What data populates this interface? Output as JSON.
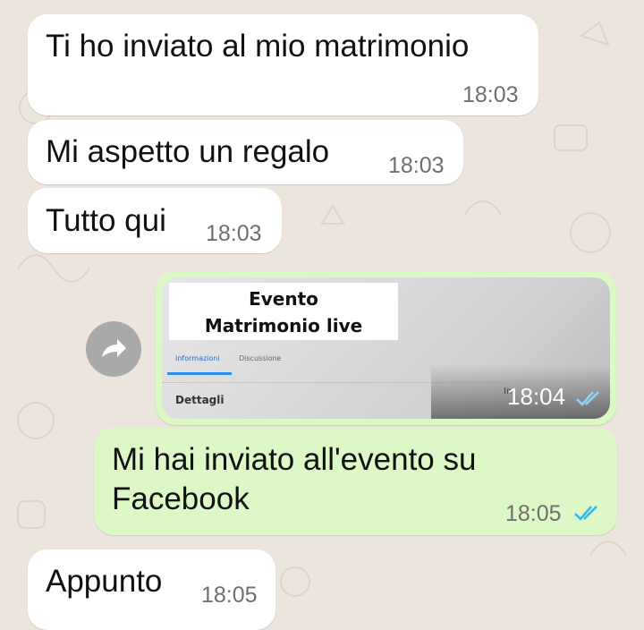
{
  "colors": {
    "background": "#ece5dd",
    "incoming_bubble": "#ffffff",
    "outgoing_bubble": "#dcf8c6",
    "read_ticks": "#34b7f1",
    "timestamp": "#6f6f6f"
  },
  "messages": [
    {
      "direction": "incoming",
      "text": "Ti ho inviato al mio matrimonio",
      "time": "18:03"
    },
    {
      "direction": "incoming",
      "text": "Mi aspetto un regalo",
      "time": "18:03"
    },
    {
      "direction": "incoming",
      "text": "Tutto qui",
      "time": "18:03"
    },
    {
      "direction": "outgoing",
      "type": "image",
      "time": "18:04",
      "status": "read",
      "status_icon": "double-check-icon",
      "image": {
        "caption_line1": "Evento",
        "caption_line2": "Matrimonio live",
        "tab_info": "Informazioni",
        "tab_discussion": "Discussione",
        "details_label": "Dettagli",
        "overlay_glyph": "In"
      }
    },
    {
      "direction": "outgoing",
      "text_line1": "Mi hai inviato all'evento su",
      "text_line2": "Facebook",
      "time": "18:05",
      "status": "read",
      "status_icon": "double-check-icon"
    },
    {
      "direction": "incoming",
      "text": "Appunto",
      "time": "18:05"
    }
  ],
  "forward_button": {
    "icon": "forward-arrow-icon"
  }
}
